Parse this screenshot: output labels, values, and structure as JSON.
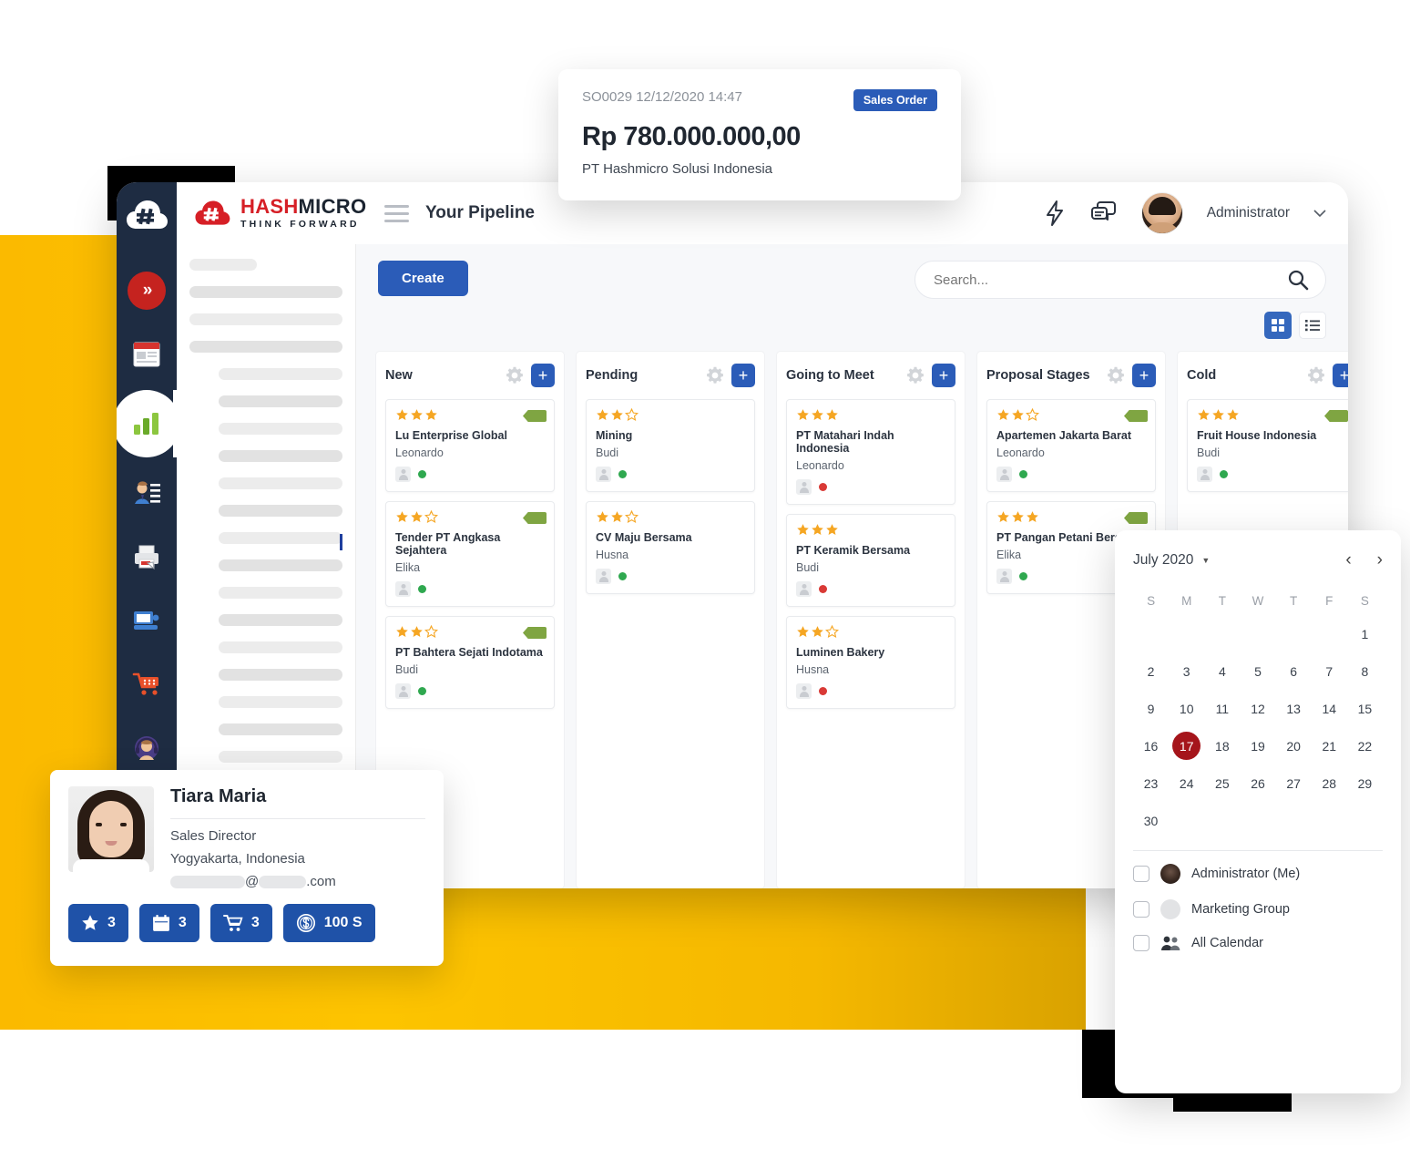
{
  "background": {
    "accent_yellow": "#FBBA00",
    "dark_navy": "#1e2c42",
    "brand_red": "#d61f26",
    "primary_blue": "#2b5cb8"
  },
  "sales_order_card": {
    "reference": "SO0029 12/12/2020 14:47",
    "badge": "Sales Order",
    "amount": "Rp 780.000.000,00",
    "company": "PT Hashmicro Solusi Indonesia"
  },
  "app": {
    "brand": {
      "name_part1": "HASH",
      "name_part2": "MICRO",
      "tagline": "THINK FORWARD"
    },
    "page_title": "Your Pipeline",
    "user": {
      "name": "Administrator"
    },
    "toolbar": {
      "create_label": "Create",
      "search_placeholder": "Search...",
      "search_value": ""
    },
    "sidebar_items": [
      {
        "name": "expand-menu",
        "icon": "chevron-double-right-icon"
      },
      {
        "name": "news",
        "icon": "newspaper-icon"
      },
      {
        "name": "reports",
        "icon": "bar-chart-icon",
        "active": true
      },
      {
        "name": "contacts",
        "icon": "person-list-icon"
      },
      {
        "name": "printing",
        "icon": "printer-icon"
      },
      {
        "name": "pos",
        "icon": "monitor-icon"
      },
      {
        "name": "sales",
        "icon": "shopping-cart-icon"
      },
      {
        "name": "support",
        "icon": "headset-icon"
      }
    ]
  },
  "pipeline": {
    "columns": [
      {
        "title": "New",
        "cards": [
          {
            "stars": 3,
            "title": "Lu Enterprise Global",
            "owner": "Leonardo",
            "dot": "#2fa84f",
            "tag": true
          },
          {
            "stars": 2,
            "title": "Tender PT Angkasa Sejahtera",
            "owner": "Elika",
            "dot": "#2fa84f",
            "tag": true
          },
          {
            "stars": 2,
            "title": "PT Bahtera Sejati Indotama",
            "owner": "Budi",
            "dot": "#2fa84f",
            "tag": true
          }
        ]
      },
      {
        "title": "Pending",
        "cards": [
          {
            "stars": 2,
            "title": "Mining",
            "owner": "Budi",
            "dot": "#2fa84f",
            "tag": false
          },
          {
            "stars": 2,
            "title": "CV Maju Bersama",
            "owner": "Husna",
            "dot": "#2fa84f",
            "tag": false
          }
        ]
      },
      {
        "title": "Going to Meet",
        "cards": [
          {
            "stars": 3,
            "title": "PT Matahari Indah Indonesia",
            "owner": "Leonardo",
            "dot": "#d93a36",
            "tag": false
          },
          {
            "stars": 3,
            "title": "PT Keramik Bersama",
            "owner": "Budi",
            "dot": "#d93a36",
            "tag": false
          },
          {
            "stars": 2,
            "title": "Luminen Bakery",
            "owner": "Husna",
            "dot": "#d93a36",
            "tag": false
          }
        ]
      },
      {
        "title": "Proposal Stages",
        "cards": [
          {
            "stars": 2,
            "title": "Apartemen Jakarta Barat",
            "owner": "Leonardo",
            "dot": "#2fa84f",
            "tag": true
          },
          {
            "stars": 3,
            "title": "PT Pangan Petani Bersama",
            "owner": "Elika",
            "dot": "#2fa84f",
            "tag": true
          }
        ]
      },
      {
        "title": "Cold",
        "cards": [
          {
            "stars": 3,
            "title": "Fruit House Indonesia",
            "owner": "Budi",
            "dot": "#2fa84f",
            "tag": true
          }
        ]
      }
    ]
  },
  "calendar": {
    "month_label": "July 2020",
    "weekdays": [
      "S",
      "M",
      "T",
      "W",
      "T",
      "F",
      "S"
    ],
    "leading_blanks": 6,
    "days": [
      1,
      2,
      3,
      4,
      5,
      6,
      7,
      8,
      9,
      10,
      11,
      12,
      13,
      14,
      15,
      16,
      17,
      18,
      19,
      20,
      21,
      22,
      23,
      24,
      25,
      26,
      27,
      28,
      29,
      30
    ],
    "today": 17,
    "today_color": "#a5151b",
    "sources": [
      {
        "label": "Administrator (Me)",
        "checked": false,
        "avatar": "admin"
      },
      {
        "label": "Marketing Group",
        "checked": false,
        "avatar": "group"
      },
      {
        "label": "All Calendar",
        "checked": false,
        "avatar": "people-icon"
      }
    ]
  },
  "contact_card": {
    "name": "Tiara Maria",
    "role": "Sales Director",
    "location": "Yogyakarta, Indonesia",
    "email_at": "@",
    "email_tld": ".com",
    "badges": [
      {
        "icon": "star-icon",
        "value": "3"
      },
      {
        "icon": "calendar-icon",
        "value": "3"
      },
      {
        "icon": "shopping-cart-icon",
        "value": "3"
      },
      {
        "icon": "dollar-coin-icon",
        "value": "100 S"
      }
    ]
  }
}
